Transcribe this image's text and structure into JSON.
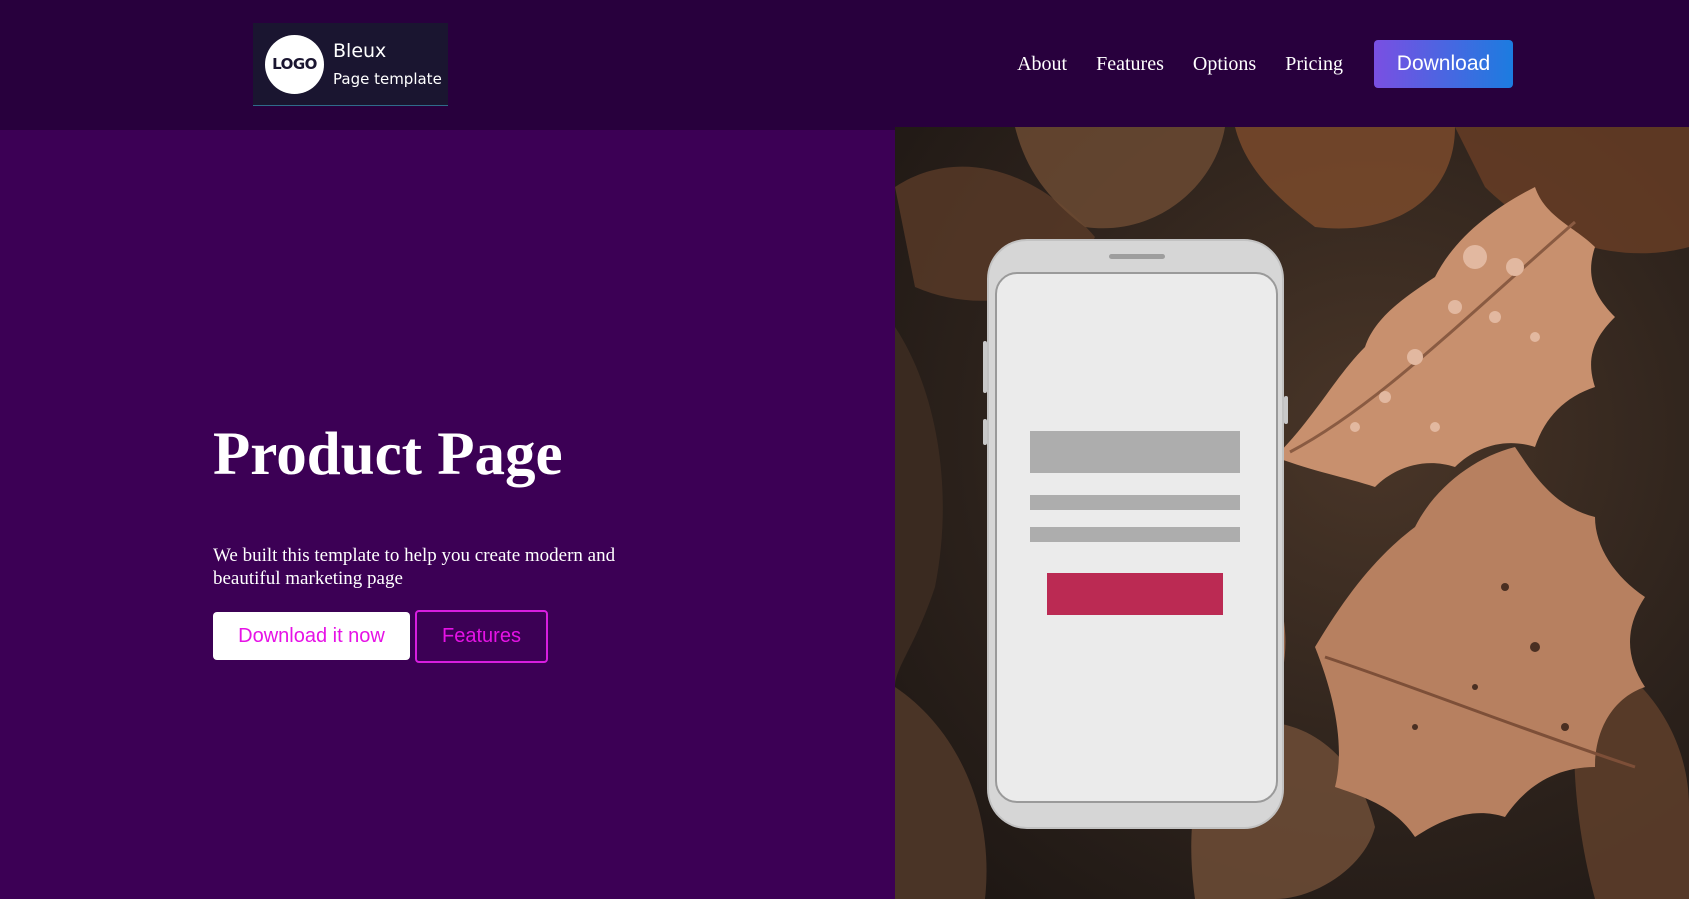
{
  "header": {
    "logo": {
      "mark": "LOGO",
      "name": "Bleux",
      "subtitle": "Page template"
    },
    "nav": [
      "About",
      "Features",
      "Options",
      "Pricing"
    ],
    "download_label": "Download"
  },
  "hero": {
    "title": "Product Page",
    "description": "We built this template to help you create modern and beautiful marketing page",
    "primary_button": "Download it now",
    "secondary_button": "Features"
  },
  "colors": {
    "header_bg": "#28003d",
    "hero_bg": "#3c0055",
    "accent": "#e612e6",
    "download_gradient_start": "#7a4fe2",
    "download_gradient_end": "#1c7ce0",
    "phone_cta": "#bb2a53"
  }
}
